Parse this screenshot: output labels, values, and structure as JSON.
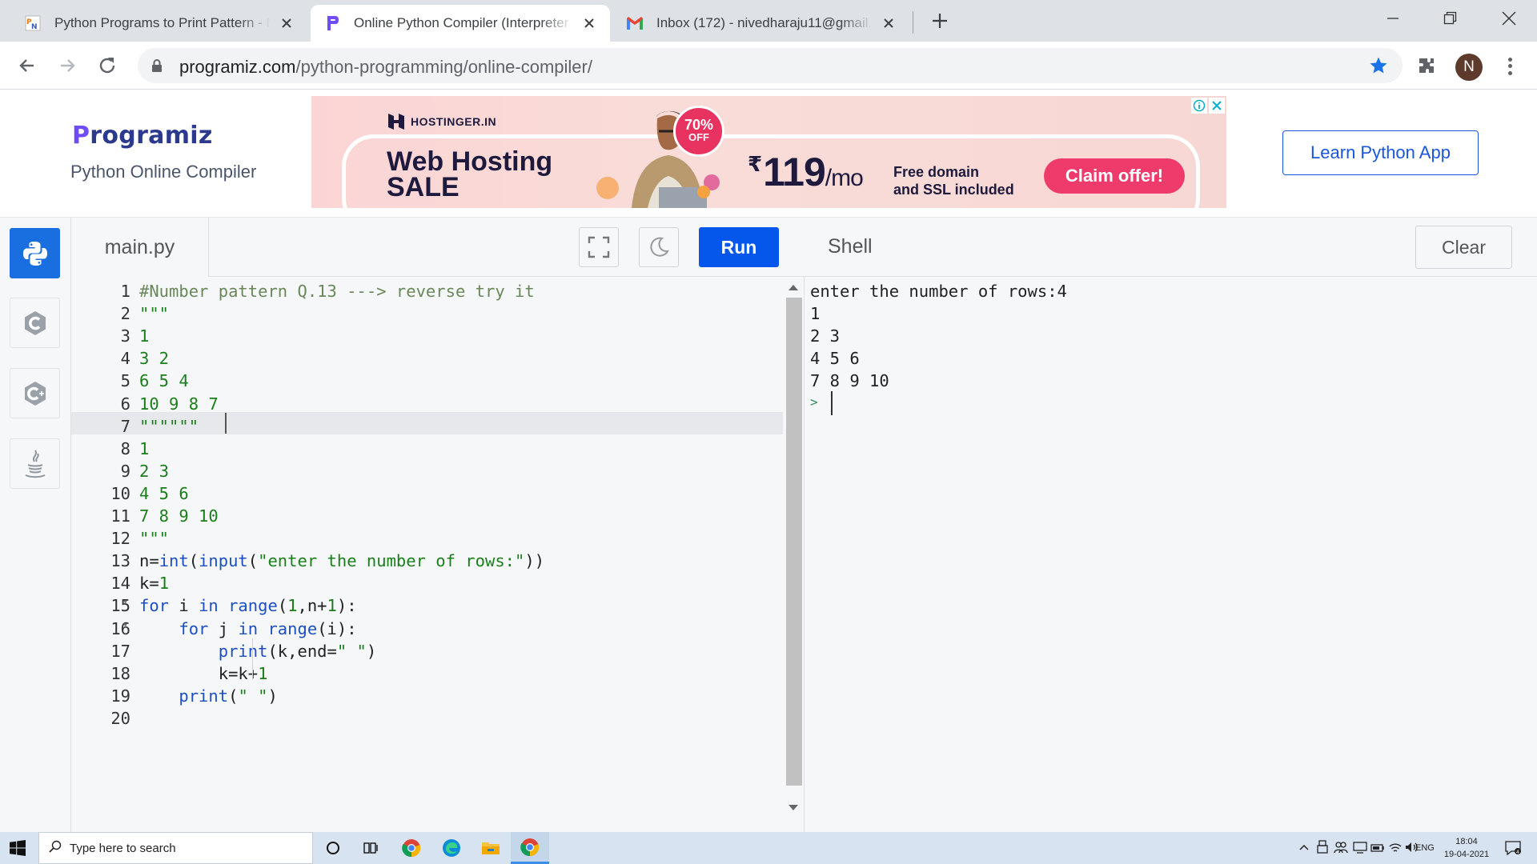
{
  "browser": {
    "tabs": [
      {
        "title": "Python Programs to Print Pattern - N",
        "icon": "pyn-favicon"
      },
      {
        "title": "Online Python Compiler (Interpreter",
        "icon": "programiz-favicon"
      },
      {
        "title": "Inbox (172) - nivedharaju11@gmail.",
        "icon": "gmail-favicon"
      }
    ],
    "active_tab_index": 1,
    "url_host": "programiz.com",
    "url_path": "/python-programming/online-compiler/",
    "profile_initial": "N"
  },
  "header": {
    "logo": "rogramiz",
    "logo_initial": "P",
    "subtitle": "Python Online Compiler",
    "learn_button": "Learn Python App"
  },
  "ad": {
    "brand": "HOSTINGER.IN",
    "headline_1": "Web Hosting",
    "headline_2": "SALE",
    "badge_pct": "70%",
    "badge_off": "OFF",
    "currency": "₹",
    "price": "119",
    "per": "/mo",
    "free_1": "Free domain",
    "free_2": "and SSL included",
    "cta": "Claim offer!"
  },
  "editor": {
    "filename": "main.py",
    "run_label": "Run",
    "highlighted_line": 7,
    "lines": [
      {
        "n": "1",
        "html": "<span class=\"c-cmt\">#Number pattern Q.13 ---&gt; reverse try it</span>"
      },
      {
        "n": "2",
        "html": "<span class=\"c-str\">\"\"\"</span>"
      },
      {
        "n": "3",
        "html": "<span class=\"c-str\">1</span>"
      },
      {
        "n": "4",
        "html": "<span class=\"c-str\">3 2</span>"
      },
      {
        "n": "5",
        "html": "<span class=\"c-str\">6 5 4</span>"
      },
      {
        "n": "6",
        "html": "<span class=\"c-str\">10 9 8 7</span>"
      },
      {
        "n": "7",
        "html": "<span class=\"c-str\">\"\"\"\"\"\"</span>"
      },
      {
        "n": "8",
        "html": "<span class=\"c-str\">1</span>"
      },
      {
        "n": "9",
        "html": "<span class=\"c-str\">2 3</span>"
      },
      {
        "n": "10",
        "html": "<span class=\"c-str\">4 5 6</span>"
      },
      {
        "n": "11",
        "html": "<span class=\"c-str\">7 8 9 10</span>"
      },
      {
        "n": "12",
        "html": "<span class=\"c-str\">\"\"\"</span>"
      },
      {
        "n": "13",
        "html": "n=<span class=\"c-fn\">int</span>(<span class=\"c-fn\">input</span>(<span class=\"c-str\">\"enter the number of rows:\"</span>))"
      },
      {
        "n": "14",
        "html": "k=<span class=\"c-str\">1</span>"
      },
      {
        "n": "15",
        "html": "<span class=\"c-kw\">for</span> i <span class=\"c-kw\">in</span> <span class=\"c-fn\">range</span>(<span class=\"c-str\">1</span>,n+<span class=\"c-str\">1</span>):",
        "fold": true
      },
      {
        "n": "16",
        "html": "    <span class=\"c-kw\">for</span> j <span class=\"c-kw\">in</span> <span class=\"c-fn\">range</span>(i):",
        "fold": true
      },
      {
        "n": "17",
        "html": "        <span class=\"c-fn\">print</span>(k,end=<span class=\"c-str\">\" \"</span>)"
      },
      {
        "n": "18",
        "html": "        k=k+<span class=\"c-str\">1</span>"
      },
      {
        "n": "19",
        "html": "    <span class=\"c-fn\">print</span>(<span class=\"c-str\">\" \"</span>)"
      },
      {
        "n": "20",
        "html": ""
      }
    ]
  },
  "shell": {
    "title": "Shell",
    "clear_label": "Clear",
    "output": [
      "enter the number of rows:4",
      "1",
      "2 3",
      "4 5 6",
      "7 8 9 10"
    ],
    "prompt": ">"
  },
  "taskbar": {
    "search_placeholder": "Type here to search",
    "lang": "ENG",
    "time": "18:04",
    "date": "19-04-2021"
  },
  "colors": {
    "accent": "#0557ec",
    "active_lang": "#1a6fe0",
    "string": "#1a7f1a",
    "keyword": "#1d4fc4"
  }
}
